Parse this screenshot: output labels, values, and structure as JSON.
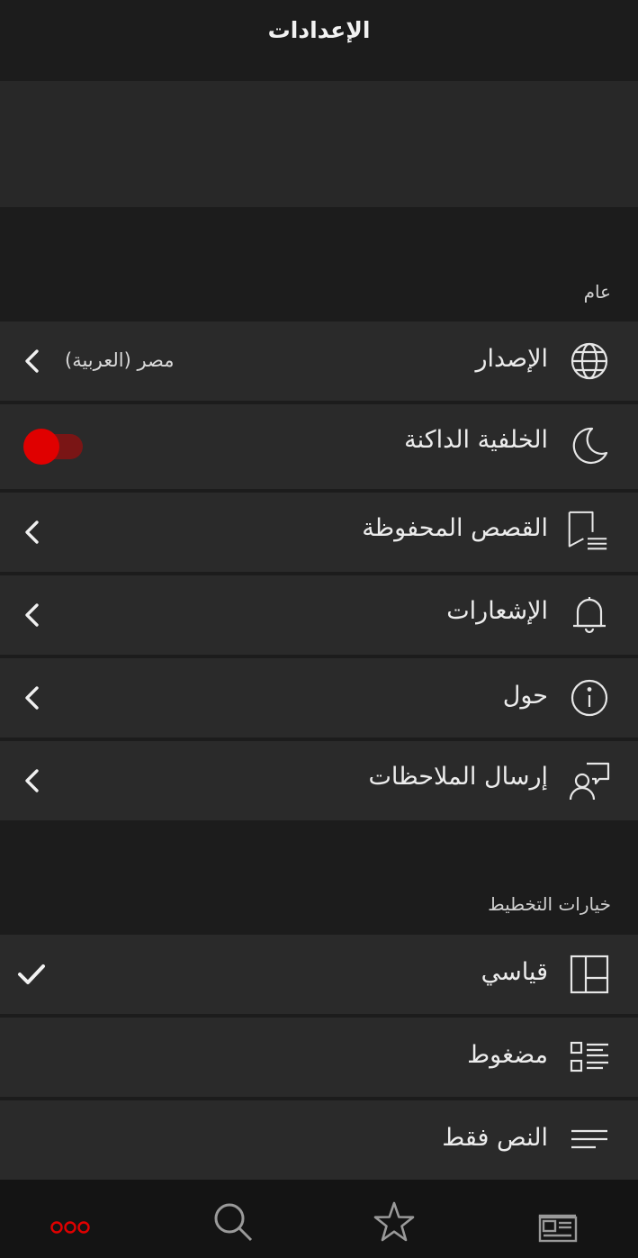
{
  "header": {
    "title": "الإعدادات"
  },
  "sections": {
    "general": "عام",
    "layout": "خيارات التخطيط"
  },
  "settings": {
    "edition": {
      "label": "الإصدار",
      "value": "مصر (العربية)",
      "icon": "globe-icon"
    },
    "dark_mode": {
      "label": "الخلفية الداكنة",
      "icon": "moon-icon",
      "enabled": true
    },
    "saved_stories": {
      "label": "القصص المحفوظة",
      "icon": "bookmark-list-icon"
    },
    "notifications": {
      "label": "الإشعارات",
      "icon": "bell-icon"
    },
    "about": {
      "label": "حول",
      "icon": "info-icon"
    },
    "feedback": {
      "label": "إرسال الملاحظات",
      "icon": "feedback-icon"
    }
  },
  "layout_options": [
    {
      "label": "قياسي",
      "icon": "standard-layout-icon",
      "selected": true
    },
    {
      "label": "مضغوط",
      "icon": "compact-layout-icon",
      "selected": false
    },
    {
      "label": "النص فقط",
      "icon": "text-only-icon",
      "selected": false
    }
  ],
  "bottom_nav": {
    "items": [
      "more-icon",
      "search-icon",
      "star-icon",
      "news-icon"
    ],
    "active": "more-icon"
  },
  "colors": {
    "accent": "#e00000",
    "background": "#1c1c1c",
    "row": "#2a2a2a"
  }
}
